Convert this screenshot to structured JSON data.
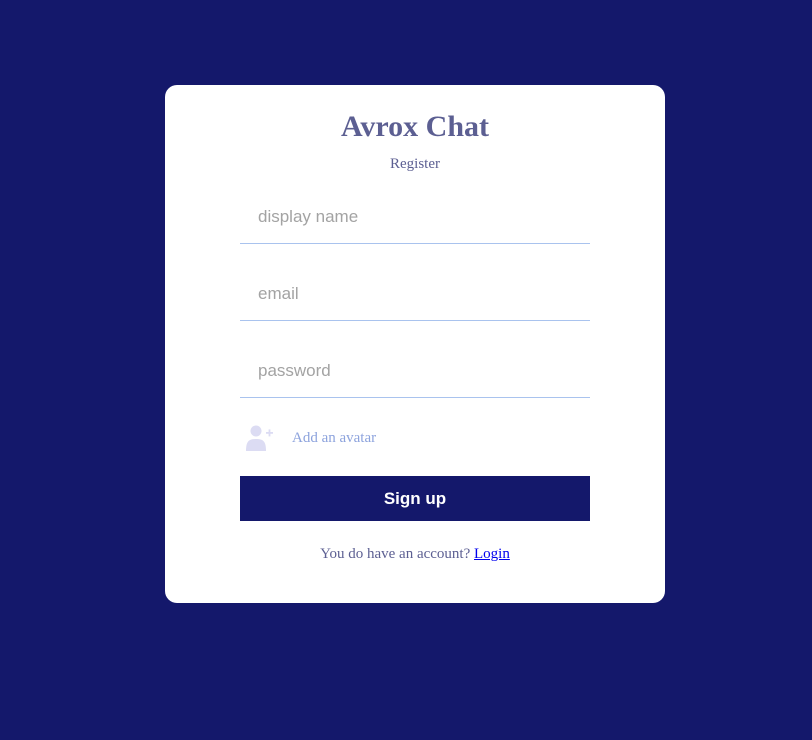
{
  "app": {
    "title": "Avrox Chat",
    "subtitle": "Register"
  },
  "form": {
    "display_name": {
      "placeholder": "display name",
      "value": ""
    },
    "email": {
      "placeholder": "email",
      "value": ""
    },
    "password": {
      "placeholder": "password",
      "value": ""
    },
    "avatar_label": "Add an avatar",
    "avatar_icon": "add-user-icon",
    "submit_label": "Sign up"
  },
  "footer": {
    "prompt": "You do have an account? ",
    "login_link": "Login"
  },
  "colors": {
    "background": "#14186b",
    "card": "#ffffff",
    "title": "#5c5f92",
    "field_underline": "#a9c3ee",
    "avatar_accent": "#8da3dd",
    "link": "#0000ee"
  }
}
